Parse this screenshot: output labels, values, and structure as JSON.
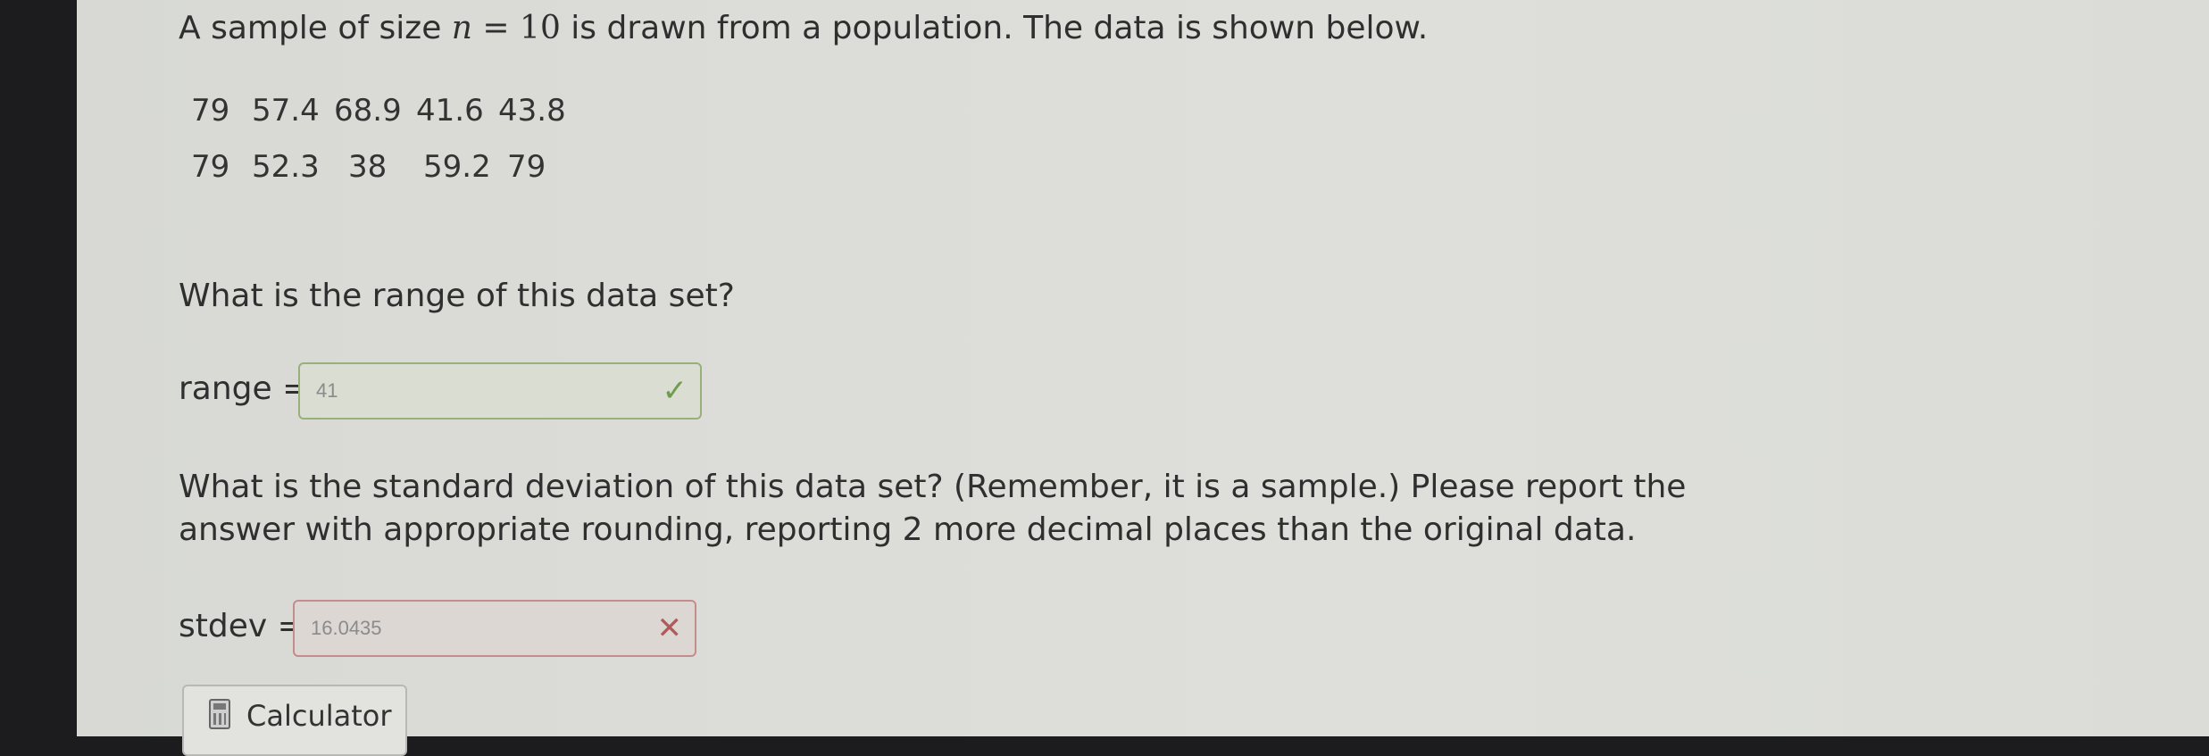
{
  "problem": {
    "intro_prefix": "A sample of size ",
    "n_var": "n",
    "equals": " = ",
    "n_value": "10",
    "intro_suffix": " is drawn from a population. The data is shown below.",
    "data_rows": [
      [
        "79",
        "57.4",
        "68.9",
        "41.6",
        "43.8"
      ],
      [
        "79",
        "52.3",
        "38",
        "59.2",
        "79"
      ]
    ]
  },
  "range_question": {
    "prompt": "What is the range of this data set?",
    "label": "range =",
    "answer": "41",
    "status": "correct",
    "status_icon": "check-icon",
    "status_color": "#6f9c4e"
  },
  "stdev_question": {
    "prompt_line1": "What is the standard deviation of this data set? (Remember, it is a sample.) Please report the",
    "prompt_line2": "answer with appropriate rounding, reporting 2 more decimal places than the original data.",
    "label": "stdev =",
    "answer": "16.0435",
    "status": "incorrect",
    "status_icon": "cross-icon",
    "status_color": "#b15a5a"
  },
  "calculator": {
    "label": "Calculator",
    "icon": "calculator-icon"
  }
}
